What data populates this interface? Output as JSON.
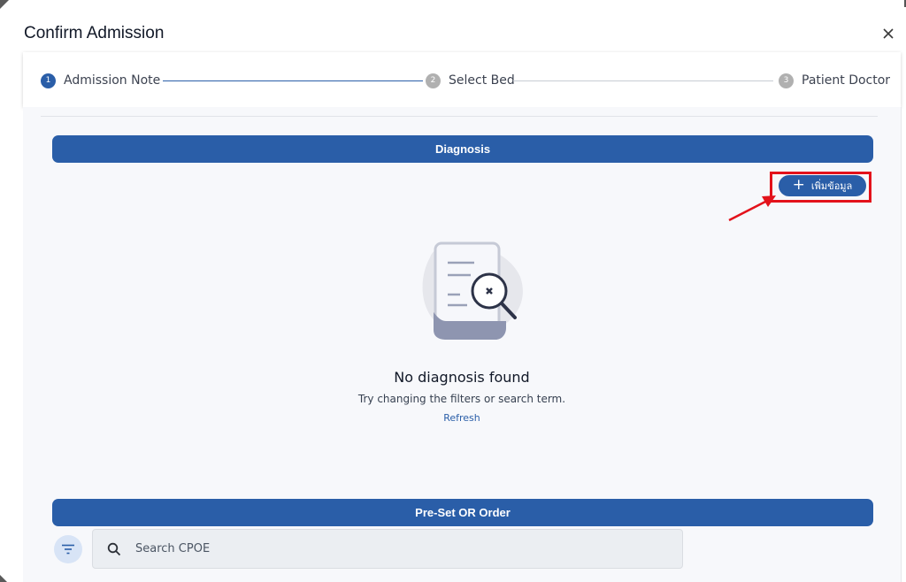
{
  "modal": {
    "title": "Confirm Admission"
  },
  "stepper": {
    "steps": [
      {
        "number": "1",
        "label": "Admission Note",
        "state": "active"
      },
      {
        "number": "2",
        "label": "Select Bed",
        "state": "inactive"
      },
      {
        "number": "3",
        "label": "Patient Doctor",
        "state": "inactive"
      }
    ]
  },
  "diagnosis": {
    "header": "Diagnosis",
    "add_button": "เพิ่มข้อมูล",
    "empty_state": {
      "title": "No diagnosis found",
      "subtitle": "Try changing the filters or search term.",
      "refresh": "Refresh"
    }
  },
  "order": {
    "header": "Pre-Set OR Order",
    "search_placeholder": "Search CPOE"
  },
  "icons": {
    "close": "close-icon",
    "filter": "filter-icon",
    "search": "search-icon",
    "plus": "plus-icon",
    "illustration": "document-magnifier-icon"
  },
  "colors": {
    "primary": "#2a5ea8",
    "highlight": "#e3121b",
    "background": "#f7f8fb"
  }
}
